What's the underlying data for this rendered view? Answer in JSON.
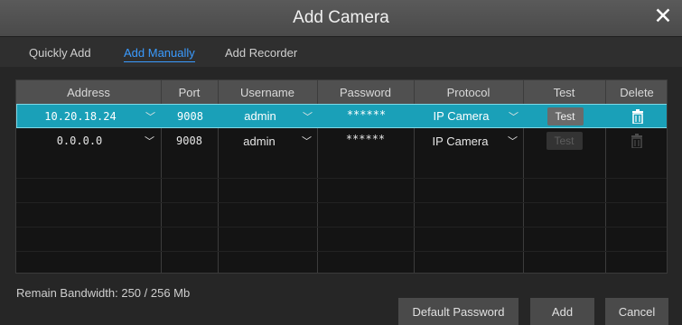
{
  "dialog": {
    "title": "Add Camera"
  },
  "tabs": [
    {
      "label": "Quickly Add"
    },
    {
      "label": "Add Manually"
    },
    {
      "label": "Add Recorder"
    }
  ],
  "table": {
    "columns": [
      "Address",
      "Port",
      "Username",
      "Password",
      "Protocol",
      "Test",
      "Delete"
    ],
    "rows": [
      {
        "address": "10.20.18.24",
        "port": "9008",
        "username": "admin",
        "password": "******",
        "protocol": "IP Camera",
        "test": "Test",
        "selected": true
      },
      {
        "address": "0.0.0.0",
        "port": "9008",
        "username": "admin",
        "password": "******",
        "protocol": "IP Camera",
        "test": "Test",
        "selected": false
      }
    ]
  },
  "footer": {
    "bandwidth": "Remain Bandwidth: 250 / 256 Mb",
    "default_password": "Default Password",
    "add": "Add",
    "cancel": "Cancel"
  },
  "colors": {
    "selected_row": "#1aa0b8",
    "active_tab": "#3a9bff",
    "header": "#505050"
  },
  "icons": {
    "close": "close-icon",
    "dropdown": "chevron-down-icon",
    "delete": "trash-icon"
  }
}
